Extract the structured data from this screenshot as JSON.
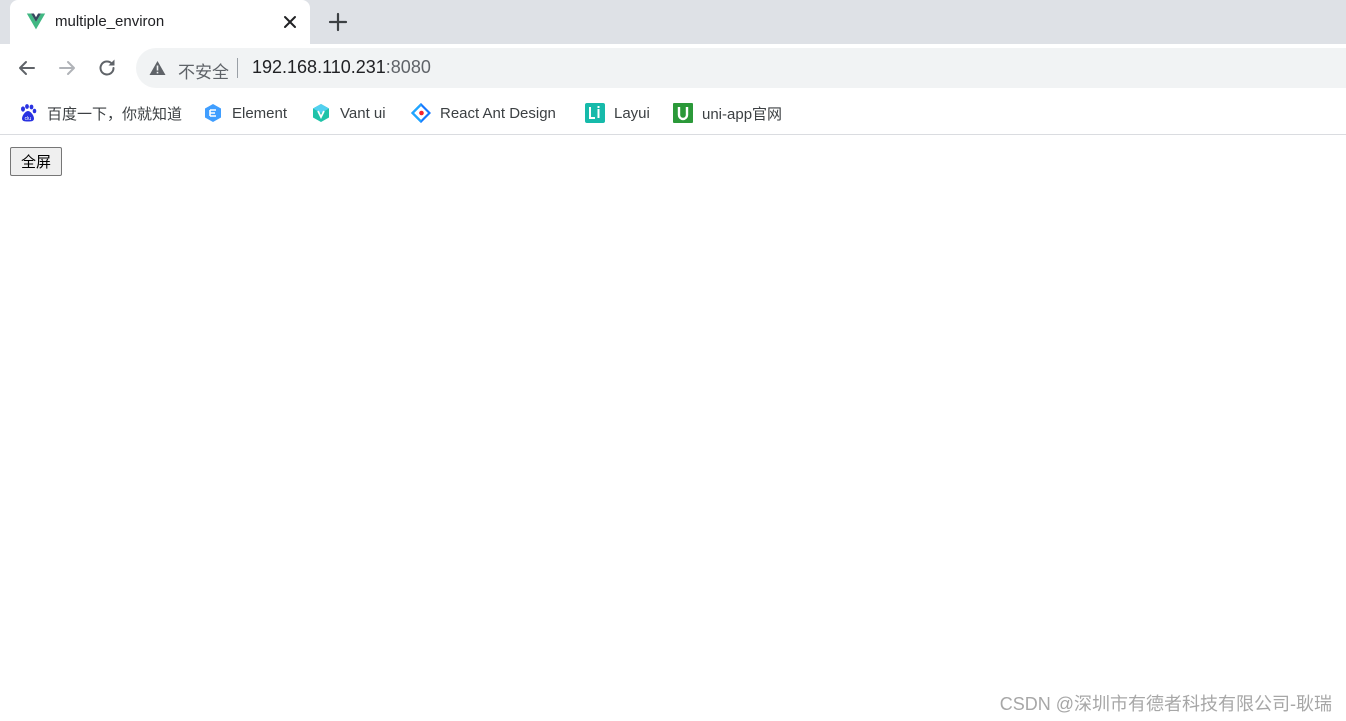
{
  "tab": {
    "title": "multiple_environ",
    "favicon": "vue-icon"
  },
  "toolbar": {
    "security_label": "不安全",
    "url_host": "192.168.110.231",
    "url_port": ":8080"
  },
  "bookmarks": [
    {
      "label": "百度一下，你就知道",
      "icon": "baidu-paw-icon",
      "color": "#2932e1"
    },
    {
      "label": "Element",
      "icon": "element-icon",
      "color": "#409eff"
    },
    {
      "label": "Vant ui",
      "icon": "vant-icon",
      "color": "#07c160"
    },
    {
      "label": "React Ant Design",
      "icon": "ant-design-icon",
      "color": "#1677ff"
    },
    {
      "label": "Layui",
      "icon": "layui-icon",
      "color": "#16baaa"
    },
    {
      "label": "uni-app官网",
      "icon": "uniapp-icon",
      "color": "#2b9939"
    }
  ],
  "page": {
    "fullscreen_label": "全屏"
  },
  "watermark": "CSDN @深圳市有德者科技有限公司-耿瑞",
  "colors": {
    "tabstrip": "#dee1e6",
    "omnibox": "#f1f3f4",
    "text": "#202124"
  }
}
